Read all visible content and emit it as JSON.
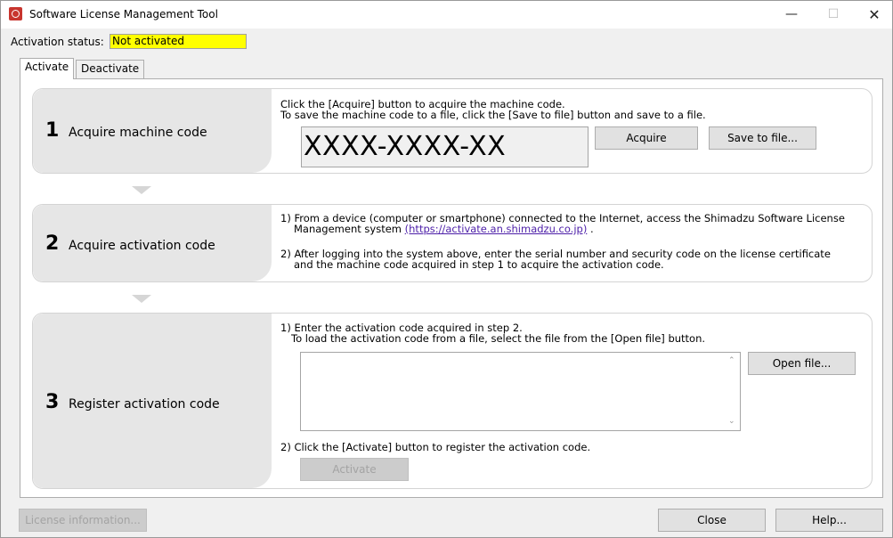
{
  "window": {
    "title": "Software License Management Tool",
    "minimize_glyph": "—",
    "maximize_glyph": "☐",
    "close_glyph": "✕"
  },
  "status": {
    "label": "Activation status:",
    "value": "Not activated",
    "value_bg": "#ffff00"
  },
  "tabs": [
    {
      "label": "Activate",
      "active": true
    },
    {
      "label": "Deactivate",
      "active": false
    }
  ],
  "steps": {
    "one": {
      "number": "1",
      "title": "Acquire machine code",
      "line1": "Click the [Acquire] button to acquire the machine code.",
      "line2": "To save the machine code to a file, click the [Save to file] button and save to a file.",
      "machine_code": "XXXX-XXXX-XX",
      "acquire_label": "Acquire",
      "save_label": "Save to file..."
    },
    "two": {
      "number": "2",
      "title": "Acquire activation code",
      "p1_line1": "1) From a device (computer or smartphone) connected to the Internet, access the Shimadzu Software License",
      "p1_line2_prefix": "Management system ",
      "p1_link": "(https://activate.an.shimadzu.co.jp)",
      "p1_line2_suffix": " .",
      "p2_line1": "2) After logging into the system above, enter the serial number and security code on the license certificate",
      "p2_line2": "and the machine code acquired in step 1 to acquire the activation code."
    },
    "three": {
      "number": "3",
      "title": "Register activation code",
      "l1": "1) Enter the activation code acquired in step 2.",
      "l2": "To load the activation code from a file, select the file from the [Open file] button.",
      "open_label": "Open file...",
      "l3": "2) Click the [Activate] button to register the activation code.",
      "activate_label": "Activate",
      "code_value": ""
    }
  },
  "footer": {
    "license_info_label": "License information...",
    "close_label": "Close",
    "help_label": "Help..."
  },
  "icons": {
    "scroll_up": "up-chevron",
    "scroll_down": "down-chevron",
    "app": "shimadzu-app-icon"
  }
}
